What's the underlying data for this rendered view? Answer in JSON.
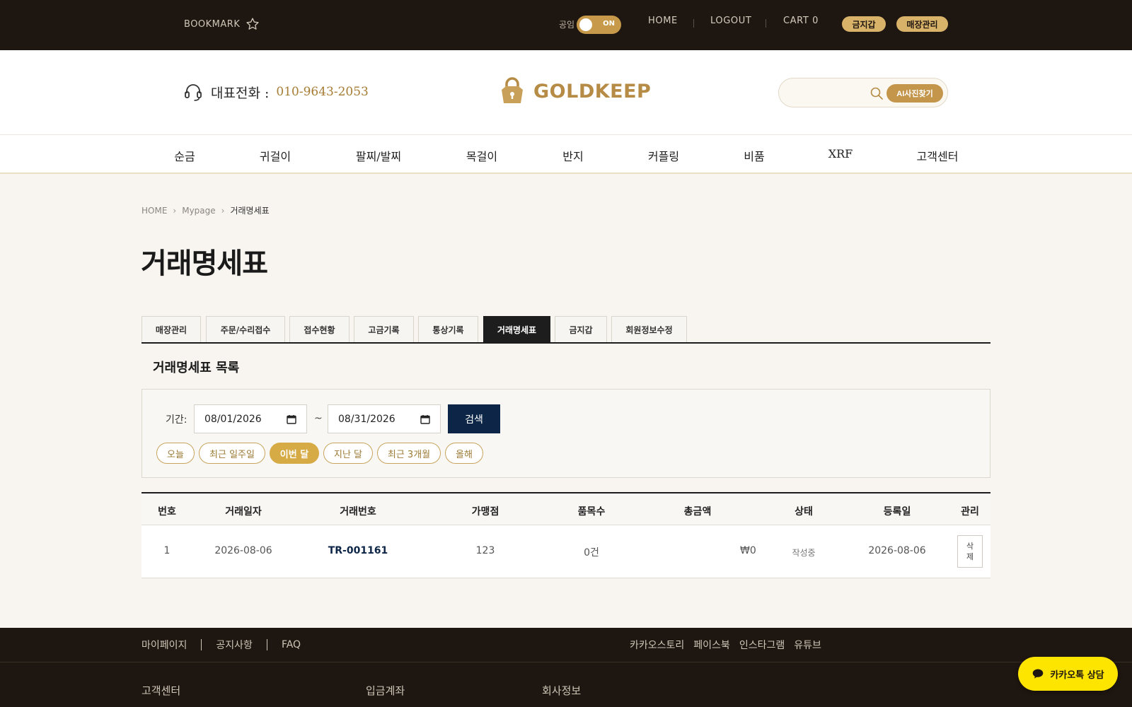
{
  "topbar": {
    "bookmark_label": "BOOKMARK",
    "public_label": "공임",
    "toggle_state": "ON",
    "nav": [
      "HOME",
      "LOGOUT",
      "CART 0"
    ],
    "pills": [
      "금지갑",
      "매장관리"
    ]
  },
  "header": {
    "phone_label": "대표전화 :",
    "phone_number": "010-9643-2053",
    "logo_text": "GOLDKEEP",
    "search_placeholder": "",
    "ai_button": "AI사진찾기"
  },
  "mainnav": [
    "순금",
    "귀걸이",
    "팔찌/발찌",
    "목걸이",
    "반지",
    "커플링",
    "비품",
    "XRF",
    "고객센터"
  ],
  "breadcrumb": [
    "HOME",
    "Mypage",
    "거래명세표"
  ],
  "page_title": "거래명세표",
  "tabs": {
    "items": [
      "매장관리",
      "주문/수리접수",
      "접수현황",
      "고금기록",
      "통상기록",
      "거래명세표",
      "금지갑",
      "회원정보수정"
    ],
    "active_index": 5
  },
  "section_title": "거래명세표 목록",
  "filter": {
    "period_label": "기간:",
    "date_from": "08/01/2026",
    "date_to": "08/31/2026",
    "separator": "~",
    "search_button": "검색",
    "quick_ranges": [
      "오늘",
      "최근 일주일",
      "이번 달",
      "지난 달",
      "최근 3개월",
      "올해"
    ],
    "active_range_index": 2
  },
  "table": {
    "headers": [
      "번호",
      "거래일자",
      "거래번호",
      "가맹점",
      "품목수",
      "총금액",
      "상태",
      "등록일",
      "관리"
    ],
    "rows": [
      {
        "no": "1",
        "date": "2026-08-06",
        "tx_no": "TR-001161",
        "store": "123",
        "items": "0건",
        "total": "₩0",
        "status": "작성중",
        "registered": "2026-08-06",
        "action": "삭제"
      }
    ]
  },
  "footer": {
    "links": [
      "마이페이지",
      "공지사항",
      "FAQ"
    ],
    "social": [
      "카카오스토리",
      "페이스북",
      "인스타그램",
      "유튜브"
    ],
    "columns": [
      "고객센터",
      "입금계좌",
      "회사정보"
    ]
  },
  "kakao_button": "카카오톡 상담",
  "colors": {
    "topbar_bg": "#1e1610",
    "gold": "#c3964c",
    "navy": "#0d2647",
    "chip_active": "#d6ab46",
    "kakao": "#fee500"
  }
}
